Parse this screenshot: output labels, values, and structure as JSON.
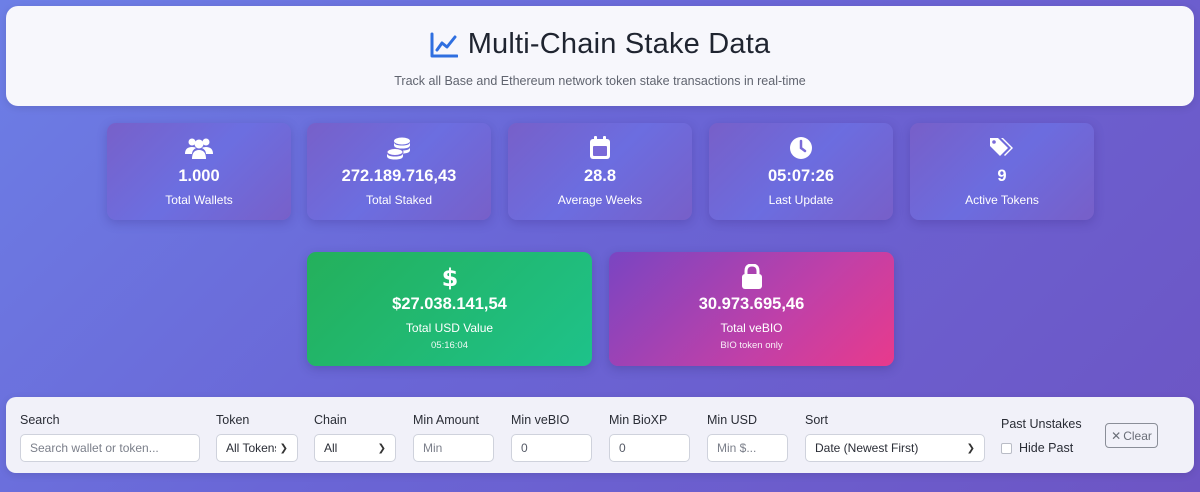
{
  "header": {
    "icon": "chart-line-icon",
    "title": "Multi-Chain Stake Data",
    "subtitle": "Track all Base and Ethereum network token stake transactions in real-time"
  },
  "stats": [
    {
      "icon": "users-icon",
      "value": "1.000",
      "label": "Total Wallets"
    },
    {
      "icon": "coins-icon",
      "value": "272.189.716,43",
      "label": "Total Staked"
    },
    {
      "icon": "calendar-icon",
      "value": "28.8",
      "label": "Average Weeks"
    },
    {
      "icon": "clock-icon",
      "value": "05:07:26",
      "label": "Last Update"
    },
    {
      "icon": "tags-icon",
      "value": "9",
      "label": "Active Tokens"
    }
  ],
  "usd_card": {
    "icon": "dollar-icon",
    "value": "$27.038.141,54",
    "label": "Total USD Value",
    "sub": "05:16:04",
    "colors": [
      "#24b05b",
      "#1ec28a"
    ]
  },
  "vebio_card": {
    "icon": "lock-icon",
    "value": "30.973.695,46",
    "label": "Total veBIO",
    "sub": "BIO token only",
    "colors": [
      "#7a45c2",
      "#e83a8c"
    ]
  },
  "filters": {
    "search": {
      "label": "Search",
      "placeholder": "Search wallet or token..."
    },
    "token": {
      "label": "Token",
      "selected": "All Tokens"
    },
    "chain": {
      "label": "Chain",
      "selected": "All"
    },
    "min_amount": {
      "label": "Min Amount",
      "placeholder": "Min"
    },
    "min_vebio": {
      "label": "Min veBIO",
      "value": "0"
    },
    "min_bioxp": {
      "label": "Min BioXP",
      "value": "0"
    },
    "min_usd": {
      "label": "Min USD",
      "placeholder": "Min $..."
    },
    "sort": {
      "label": "Sort",
      "selected": "Date (Newest First)"
    },
    "past_unstakes": {
      "label": "Past Unstakes",
      "checkbox_label": "Hide Past",
      "checked": false
    },
    "clear_label": "Clear"
  }
}
